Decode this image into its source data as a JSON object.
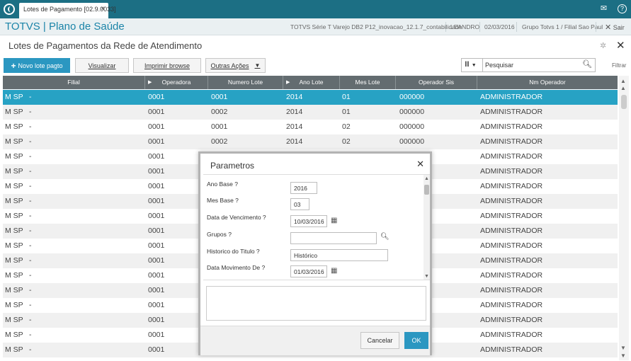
{
  "titlebar": {
    "tab_label": "Lotes de Pagamento [02.9.0033]",
    "tab_close": "×",
    "mail_icon": "mail-icon",
    "help_icon": "help-icon"
  },
  "appbar": {
    "brand": "TOTVS | Plano de Saúde",
    "info": [
      "TOTVS Série T Varejo DB2 P12_inovacao_12.1.7_contabilidade",
      "LEANDRO",
      "02/03/2016",
      "Grupo Totvs 1 / Filial Sao Paul"
    ],
    "sair": "Sair"
  },
  "page": {
    "title": "Lotes de Pagamentos da Rede de Atendimento"
  },
  "toolbar": {
    "new": "Novo lote pagto",
    "view": "Visualizar",
    "print": "Imprimir browse",
    "more": "Outras Ações"
  },
  "search": {
    "placeholder": "Pesquisar",
    "filter": "Filtrar"
  },
  "table": {
    "columns": [
      "Filial",
      "Operadora",
      "Numero Lote",
      "Ano Lote",
      "Mes Lote",
      "Operador Sis",
      "Nm Operador"
    ],
    "rows": [
      [
        "M SP",
        "-",
        "0001",
        "0001",
        "2014",
        "01",
        "000000",
        "ADMINISTRADOR"
      ],
      [
        "M SP",
        "-",
        "0001",
        "0002",
        "2014",
        "01",
        "000000",
        "ADMINISTRADOR"
      ],
      [
        "M SP",
        "-",
        "0001",
        "0001",
        "2014",
        "02",
        "000000",
        "ADMINISTRADOR"
      ],
      [
        "M SP",
        "-",
        "0001",
        "0002",
        "2014",
        "02",
        "000000",
        "ADMINISTRADOR"
      ],
      [
        "M SP",
        "-",
        "0001",
        "",
        "",
        "",
        "",
        "ADMINISTRADOR"
      ],
      [
        "M SP",
        "-",
        "0001",
        "",
        "",
        "",
        "",
        "ADMINISTRADOR"
      ],
      [
        "M SP",
        "-",
        "0001",
        "",
        "",
        "",
        "",
        "ADMINISTRADOR"
      ],
      [
        "M SP",
        "-",
        "0001",
        "",
        "",
        "",
        "",
        "ADMINISTRADOR"
      ],
      [
        "M SP",
        "-",
        "0001",
        "",
        "",
        "",
        "",
        "ADMINISTRADOR"
      ],
      [
        "M SP",
        "-",
        "0001",
        "",
        "",
        "",
        "",
        "ADMINISTRADOR"
      ],
      [
        "M SP",
        "-",
        "0001",
        "",
        "",
        "",
        "",
        "ADMINISTRADOR"
      ],
      [
        "M SP",
        "-",
        "0001",
        "",
        "",
        "",
        "",
        "ADMINISTRADOR"
      ],
      [
        "M SP",
        "-",
        "0001",
        "",
        "",
        "",
        "",
        "ADMINISTRADOR"
      ],
      [
        "M SP",
        "-",
        "0001",
        "",
        "",
        "",
        "",
        "ADMINISTRADOR"
      ],
      [
        "M SP",
        "-",
        "0001",
        "",
        "",
        "",
        "",
        "ADMINISTRADOR"
      ],
      [
        "M SP",
        "-",
        "0001",
        "",
        "",
        "",
        "",
        "ADMINISTRADOR"
      ],
      [
        "M SP",
        "-",
        "0001",
        "",
        "",
        "",
        "",
        "ADMINISTRADOR"
      ],
      [
        "M SP",
        "-",
        "0001",
        "",
        "",
        "",
        "",
        "ADMINISTRADOR"
      ]
    ]
  },
  "modal": {
    "title": "Parametros",
    "fields": [
      {
        "label": "Ano Base ?",
        "value": "2016"
      },
      {
        "label": "Mes Base ?",
        "value": "03"
      },
      {
        "label": "Data de Vencimento ?",
        "value": "10/03/2016"
      },
      {
        "label": "Grupos ?",
        "value": ""
      },
      {
        "label": "Historico do Titulo ?",
        "value": "Histórico"
      },
      {
        "label": "Data Movimento De ?",
        "value": "01/03/2016"
      }
    ],
    "cancel": "Cancelar",
    "ok": "OK"
  }
}
